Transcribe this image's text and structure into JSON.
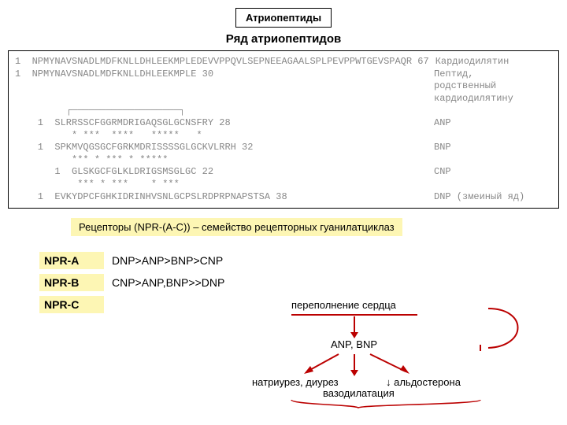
{
  "header": {
    "title": "Атриопептиды",
    "subtitle": "Ряд атриопептидов"
  },
  "sequences": [
    {
      "line": "1  NPMYNAVSNADLMDFKNLLDHLEEKMPLEDEVVPPQVLSEPNEEAGAALSPLPEVPPWTGEVSPAQR 67",
      "label": "Кардиодилятин"
    },
    {
      "line": "",
      "label": ""
    },
    {
      "line": "1  NPMYNAVSNADLMDFKNLLDHLEEKMPLE 30",
      "label": "Пептид,"
    },
    {
      "line": "",
      "label": "родственный"
    },
    {
      "line": "",
      "label": "кардиодилятину"
    },
    {
      "line": "         ┌───────────────────┐",
      "label": ""
    },
    {
      "line": "    1  SLRRSSCFGGRMDRIGAQSGLGCNSFRY 28",
      "label": "ANP"
    },
    {
      "line": "          * ***  ****   *****   *",
      "label": ""
    },
    {
      "line": "    1  SPKMVQGSGCFGRKMDRISSSSGLGCKVLRRH 32",
      "label": "BNP"
    },
    {
      "line": "          *** * *** * *****",
      "label": ""
    },
    {
      "line": "       1  GLSKGCFGLKLDRIGSMSGLGC 22",
      "label": "CNP"
    },
    {
      "line": "           *** * ***    * ***",
      "label": ""
    },
    {
      "line": "    1  EVKYDPCFGHKIDRINHVSNLGCPSLRDPRPNAPSTSA 38",
      "label": "DNP (змеиный яд)"
    }
  ],
  "receptors_note": "Рецепторы (NPR-(A-C)) – семейство рецепторных гуанилатциклаз",
  "receptors": [
    {
      "name": "NPR-A",
      "affinity": "DNP>ANP>BNP>CNP"
    },
    {
      "name": "NPR-B",
      "affinity": "CNP>ANP,BNP>>DNP"
    },
    {
      "name": "NPR-C",
      "affinity": ""
    }
  ],
  "diagram": {
    "top_label": "переполнение сердца",
    "mid_label": "ANP, BNP",
    "bottom_left": "натриурез, диурез",
    "bottom_right": "↓ альдостерона",
    "bottom_center": "вазодилатация"
  }
}
